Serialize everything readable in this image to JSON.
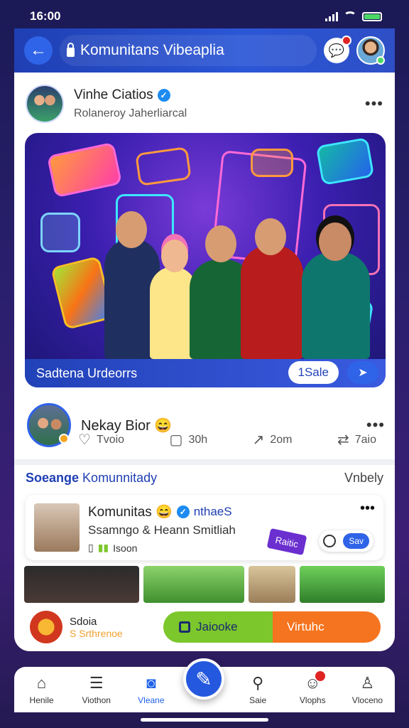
{
  "status": {
    "time": "16:00"
  },
  "header": {
    "title": "Komunitans Vibeaplia"
  },
  "post1": {
    "author": "Vinhe Ciatios",
    "subtitle": "Rolaneroy Jaherliarcal",
    "media_caption": "Sadtena Urdeorrs",
    "sale_label": "1Sale"
  },
  "post2": {
    "author": "Nekay Bior 😄",
    "actions": [
      "Tvoio",
      "30h",
      "2om",
      "7aio"
    ]
  },
  "section": {
    "title_bold": "Soeange",
    "title_rest": "Komunnitady",
    "link": "Vnbely"
  },
  "community": {
    "name": "Komunitas 😄",
    "handle": "nthaeS",
    "subtitle": "Ssamngo & Heann Smitliah",
    "meta": "Isoon",
    "sticker": "Raitic",
    "save_label": "Sav"
  },
  "bottom_card": {
    "title": "Sdoia",
    "subtitle": "S Srthrenoe",
    "cta_left": "Jaiooke",
    "cta_right": "Virtuhc"
  },
  "nav": {
    "items": [
      {
        "label": "Henile",
        "icon": "home-icon"
      },
      {
        "label": "Viothon",
        "icon": "list-icon"
      },
      {
        "label": "Vleane",
        "icon": "camera-icon"
      },
      {
        "label": "Saie",
        "icon": "search-icon"
      },
      {
        "label": "Vlophs",
        "icon": "notifications-icon"
      },
      {
        "label": "Vloceno",
        "icon": "profile-icon"
      }
    ]
  },
  "colors": {
    "brand": "#1f3fb3",
    "accent": "#2f63e8",
    "cta_green": "#7cc72b",
    "cta_orange": "#f5741f"
  }
}
